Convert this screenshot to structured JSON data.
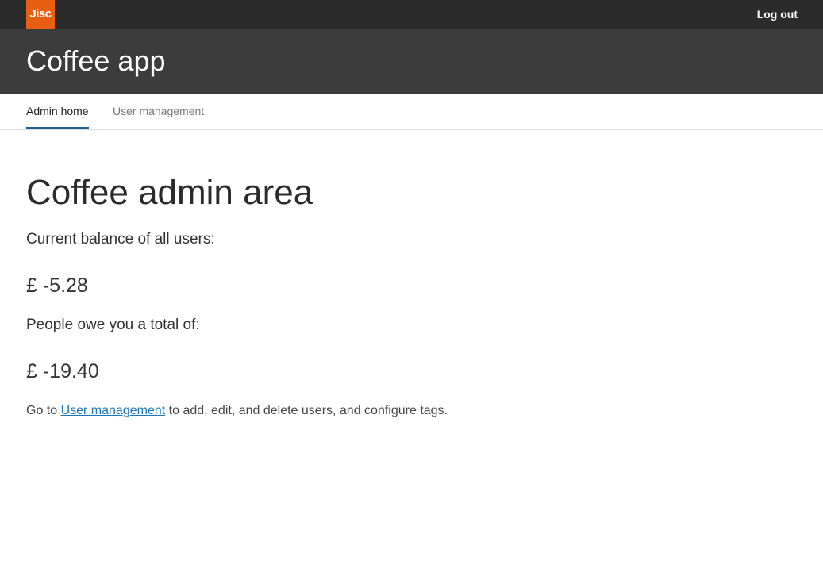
{
  "header": {
    "logo_text": "Jisc",
    "logout_label": "Log out",
    "app_title": "Coffee app"
  },
  "nav": {
    "tabs": [
      {
        "label": "Admin home",
        "active": true
      },
      {
        "label": "User management",
        "active": false
      }
    ]
  },
  "main": {
    "title": "Coffee admin area",
    "balance_label": "Current balance of all users:",
    "balance_value": "£ -5.28",
    "owed_label": "People owe you a total of:",
    "owed_value": "£ -19.40",
    "footnote_prefix": "Go to ",
    "footnote_link": "User management",
    "footnote_suffix": " to add, edit, and delete users, and configure tags."
  },
  "colors": {
    "brand_orange": "#e85e13",
    "header_dark": "#2b2b2b",
    "title_bar": "#3c3c3c",
    "active_tab_underline": "#1f5e8c",
    "link": "#1b76b5"
  }
}
